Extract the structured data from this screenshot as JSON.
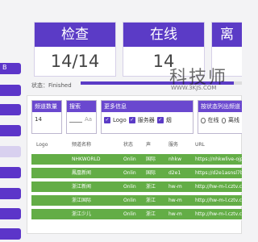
{
  "sidebar": {
    "items": [
      {
        "label": "B"
      },
      {
        "label": ""
      },
      {
        "label": ""
      },
      {
        "label": ""
      },
      {
        "label": ""
      },
      {
        "label": ""
      },
      {
        "label": ""
      },
      {
        "label": ""
      },
      {
        "label": ""
      },
      {
        "label": ""
      }
    ]
  },
  "stats": [
    {
      "title": "检查",
      "value": "14/14"
    },
    {
      "title": "在线",
      "value": "14"
    },
    {
      "title": "离",
      "value": ""
    }
  ],
  "status": {
    "text": "状态：Finished",
    "progress": 0.95
  },
  "options": {
    "channel_count": {
      "label": "频道数量",
      "value": "14"
    },
    "search": {
      "label": "搜索",
      "value": "",
      "placeholder": "Aa"
    },
    "more_info": {
      "label": "更多信息",
      "items": [
        "Logo",
        "服务器",
        "烟"
      ]
    },
    "sort": {
      "label": "按状态列出频道",
      "items": [
        "在线",
        "离线"
      ]
    }
  },
  "table": {
    "headers": [
      "Logo",
      "频道名称",
      "状态",
      "声",
      "服务",
      "URL"
    ],
    "rows": [
      [
        "",
        "NHKWORLD",
        "Onlin",
        "国际",
        "nhkw",
        "https://nhkwlive-ojp"
      ],
      [
        "",
        "鳳凰新闻",
        "Onlin",
        "国际",
        "d2e1",
        "https://d2e1asnsl7b"
      ],
      [
        "",
        "浙江新闻",
        "Onlin",
        "浙江",
        "hw-m",
        "http://hw-m-l.cztv.co"
      ],
      [
        "",
        "浙江国际",
        "Onlin",
        "浙江",
        "hw-m",
        "http://hw-m-l.cztv.co"
      ],
      [
        "",
        "浙江少儿",
        "Onlin",
        "浙江",
        "hw-m",
        "http://hw-m-l.cztv.co"
      ]
    ]
  },
  "watermark": {
    "text": "科技师",
    "url": "WWW.3KJS.COM"
  }
}
